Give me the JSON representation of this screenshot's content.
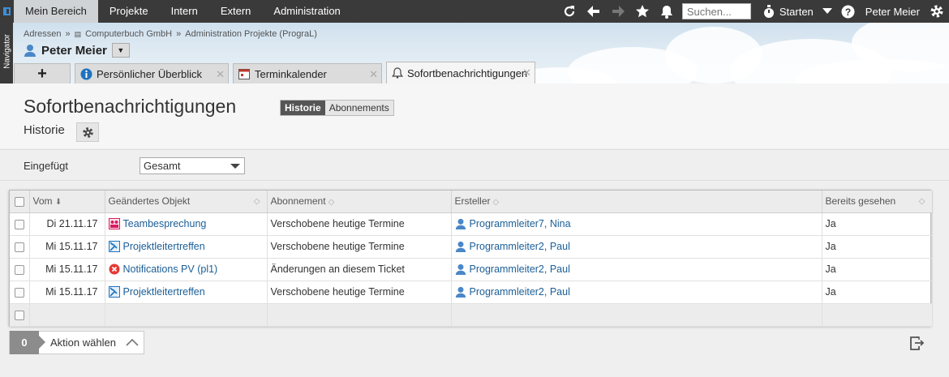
{
  "topnav": {
    "items": [
      "Mein Bereich",
      "Projekte",
      "Intern",
      "Extern",
      "Administration"
    ],
    "search_placeholder": "Suchen...",
    "start_label": "Starten",
    "user": "Peter Meier"
  },
  "navigator": {
    "label": "Navigator"
  },
  "breadcrumb": [
    "Adressen",
    "Computerbuch GmbH",
    "Administration Projekte (PrograL)"
  ],
  "person": {
    "name": "Peter Meier"
  },
  "tabs": [
    {
      "label": "Persönlicher Überblick",
      "icon": "info-icon"
    },
    {
      "label": "Terminkalender",
      "icon": "calendar-icon"
    },
    {
      "label": "Sofortbenachrichtigungen",
      "icon": "bell-icon"
    }
  ],
  "page": {
    "title": "Sofortbenachrichtigungen",
    "subtitle": "Historie",
    "segments": {
      "historie": "Historie",
      "abonnements": "Abonnements"
    }
  },
  "filter": {
    "label": "Eingefügt",
    "value": "Gesamt"
  },
  "table": {
    "headers": {
      "vom": "Vom",
      "objekt": "Geändertes Objekt",
      "abonnement": "Abonnement",
      "ersteller": "Ersteller",
      "gesehen": "Bereits gesehen"
    },
    "rows": [
      {
        "vom": "Di 21.11.17",
        "objekt": "Teambesprechung",
        "objekt_icon": "meeting-icon",
        "abonnement": "Verschobene heutige Termine",
        "ersteller": "Programmleiter7, Nina",
        "gesehen": "Ja"
      },
      {
        "vom": "Mi 15.11.17",
        "objekt": "Projektleitertreffen",
        "objekt_icon": "project-icon",
        "abonnement": "Verschobene heutige Termine",
        "ersteller": "Programmleiter2, Paul",
        "gesehen": "Ja"
      },
      {
        "vom": "Mi 15.11.17",
        "objekt": "Notifications PV (pl1)",
        "objekt_icon": "ticket-icon",
        "abonnement": "Änderungen an diesem Ticket",
        "ersteller": "Programmleiter2, Paul",
        "gesehen": "Ja"
      },
      {
        "vom": "Mi 15.11.17",
        "objekt": "Projektleitertreffen",
        "objekt_icon": "project-icon",
        "abonnement": "Verschobene heutige Termine",
        "ersteller": "Programmleiter2, Paul",
        "gesehen": "Ja"
      }
    ]
  },
  "action": {
    "count": "0",
    "label": "Aktion wählen"
  },
  "colors": {
    "topbar": "#3a3a3a",
    "link": "#1b5e96",
    "accent": "#3c8ed6"
  }
}
